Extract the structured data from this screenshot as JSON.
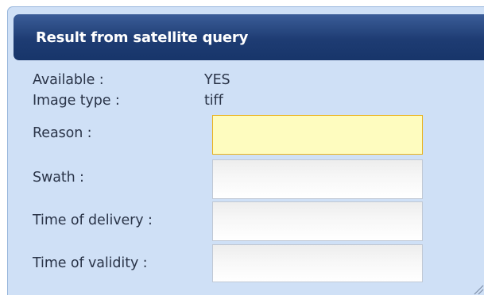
{
  "panel": {
    "title": "Result from satellite query"
  },
  "info": {
    "available_label": "Available :",
    "available_value": "YES",
    "image_type_label": "Image type :",
    "image_type_value": "tiff"
  },
  "form": {
    "reason_label": "Reason :",
    "reason_value": "",
    "swath_label": "Swath :",
    "swath_value": "",
    "time_of_delivery_label": "Time of delivery :",
    "time_of_delivery_value": "",
    "time_of_validity_label": "Time of validity :",
    "time_of_validity_value": ""
  },
  "icons": {
    "resize": "resize-grip-icon"
  },
  "colors": {
    "header_dark": "#1e3c73",
    "panel_background": "#cfe0f6",
    "focused_field": "#fefcbf",
    "focused_border": "#e9b21d"
  }
}
